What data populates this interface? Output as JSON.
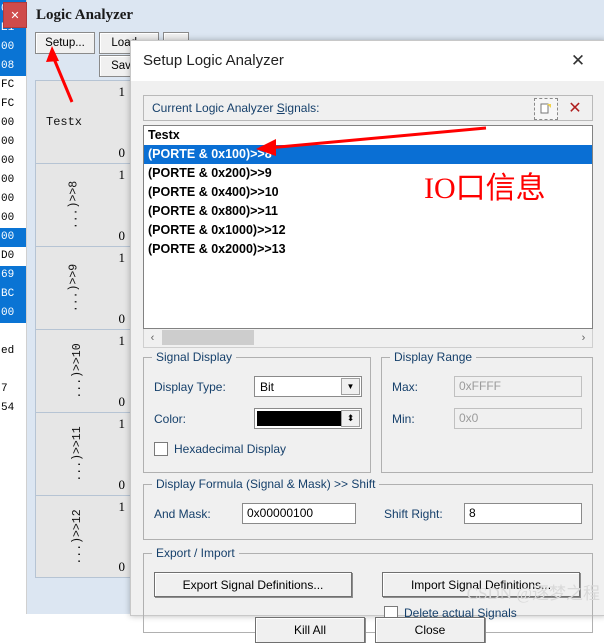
{
  "background": {
    "close_chip": "✕",
    "window_title": "Logic Analyzer",
    "buttons": {
      "setup": "Setup...",
      "load": "Load...",
      "save": "Save...",
      "extra": ""
    },
    "hex_column": [
      {
        "value": "00",
        "selected": true
      },
      {
        "value": "E1",
        "selected": true
      },
      {
        "value": "00",
        "selected": true
      },
      {
        "value": "08",
        "selected": true
      },
      {
        "value": "FC",
        "selected": false
      },
      {
        "value": "FC",
        "selected": false
      },
      {
        "value": "00",
        "selected": false
      },
      {
        "value": "00",
        "selected": false
      },
      {
        "value": "00",
        "selected": false
      },
      {
        "value": "00",
        "selected": false
      },
      {
        "value": "00",
        "selected": false
      },
      {
        "value": "00",
        "selected": false
      },
      {
        "value": "00",
        "selected": true
      },
      {
        "value": "D0",
        "selected": false
      },
      {
        "value": "69",
        "selected": true
      },
      {
        "value": "BC",
        "selected": true
      },
      {
        "value": "00",
        "selected": true
      },
      {
        "value": "",
        "selected": false
      },
      {
        "value": "ed",
        "selected": false
      },
      {
        "value": "",
        "selected": false
      },
      {
        "value": "7",
        "selected": false
      },
      {
        "value": "54",
        "selected": false
      }
    ],
    "tracks": [
      {
        "label": "Testx",
        "high": "1",
        "low": "0",
        "rotated": false
      },
      {
        "label": "...)>>8",
        "high": "1",
        "low": "0",
        "rotated": true
      },
      {
        "label": "...)>>9",
        "high": "1",
        "low": "0",
        "rotated": true
      },
      {
        "label": "...)>>10",
        "high": "1",
        "low": "0",
        "rotated": true
      },
      {
        "label": "...)>>11",
        "high": "1",
        "low": "0",
        "rotated": true
      },
      {
        "label": "...)>>12",
        "high": "1",
        "low": "0",
        "rotated": true
      }
    ],
    "annotations": {
      "io_note": "IO口信息",
      "io_note_color": "#ff0000",
      "arrow_color": "#ff0000"
    }
  },
  "dialog": {
    "title": "Setup Logic Analyzer",
    "close_icon": "✕",
    "signals_header": {
      "label_before": "Current Logic Analyzer ",
      "label_accel": "S",
      "label_after": "ignals:",
      "new_icon": "new-signal-icon",
      "delete_icon": "✕"
    },
    "signals": [
      {
        "text": "Testx",
        "selected": false
      },
      {
        "text": "(PORTE & 0x100)>>8",
        "selected": true
      },
      {
        "text": "(PORTE & 0x200)>>9",
        "selected": false
      },
      {
        "text": "(PORTE & 0x400)>>10",
        "selected": false
      },
      {
        "text": "(PORTE & 0x800)>>11",
        "selected": false
      },
      {
        "text": "(PORTE & 0x1000)>>12",
        "selected": false
      },
      {
        "text": "(PORTE & 0x2000)>>13",
        "selected": false
      }
    ],
    "hscroll": {
      "left_arrow": "‹",
      "right_arrow": "›"
    },
    "signal_display": {
      "caption": "Signal Display",
      "display_type_label": "Display Type:",
      "display_type_value": "Bit",
      "display_type_arrow": "▼",
      "color_label": "Color:",
      "color_value": "#000000",
      "color_arrow": "⬍",
      "hex_checkbox_label": "Hexadecimal Display",
      "hex_checkbox_checked": false
    },
    "display_range": {
      "caption": "Display Range",
      "max_label": "Max:",
      "max_value": "0xFFFF",
      "min_label": "Min:",
      "min_value": "0x0",
      "disabled": true
    },
    "display_formula": {
      "caption": "Display Formula (Signal & Mask) >> Shift",
      "and_mask_label": "And Mask:",
      "and_mask_value": "0x00000100",
      "shift_right_label": "Shift Right:",
      "shift_right_value": "8"
    },
    "export_import": {
      "caption": "Export / Import",
      "export_button": "Export Signal Definitions...",
      "import_button": "Import Signal Definitions...",
      "delete_checkbox_label": "Delete actual Signals",
      "delete_checkbox_checked": false
    },
    "footer": {
      "kill_all": "Kill All",
      "close": "Close"
    }
  },
  "watermark": "CSDN @逐梦之程"
}
